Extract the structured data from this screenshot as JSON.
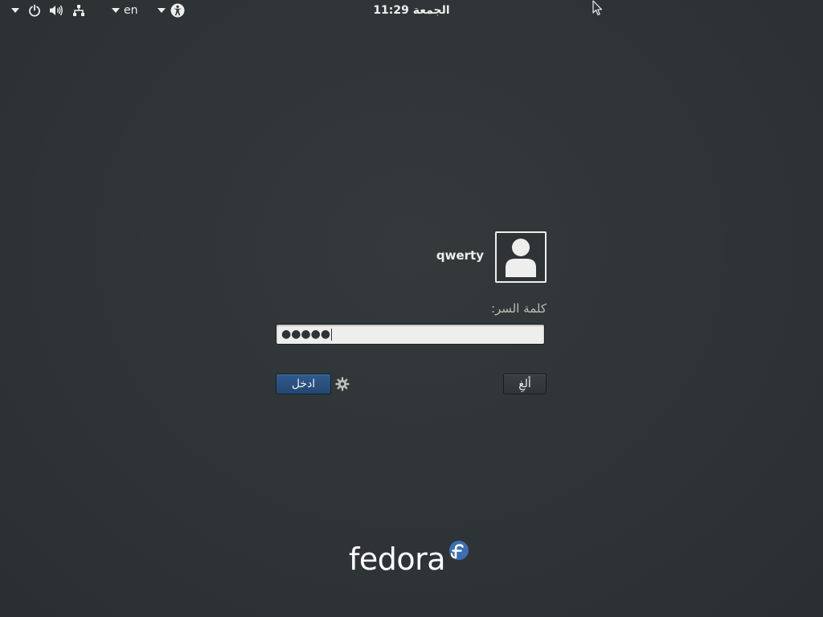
{
  "topbar": {
    "language": "en",
    "clock": "الجمعة 11:29",
    "icons": [
      "chevron-down-icon",
      "power-icon",
      "volume-icon",
      "network-icon",
      "chevron-down-icon",
      "accessibility-icon"
    ]
  },
  "login": {
    "username": "qwerty",
    "prompt_label": "كلمة السر:",
    "password_masked": "●●●●●",
    "signin_label": "ادخل",
    "cancel_label": "ألغِ"
  },
  "branding": {
    "logo_text": "fedora",
    "accent_color": "#3c6eb4"
  }
}
